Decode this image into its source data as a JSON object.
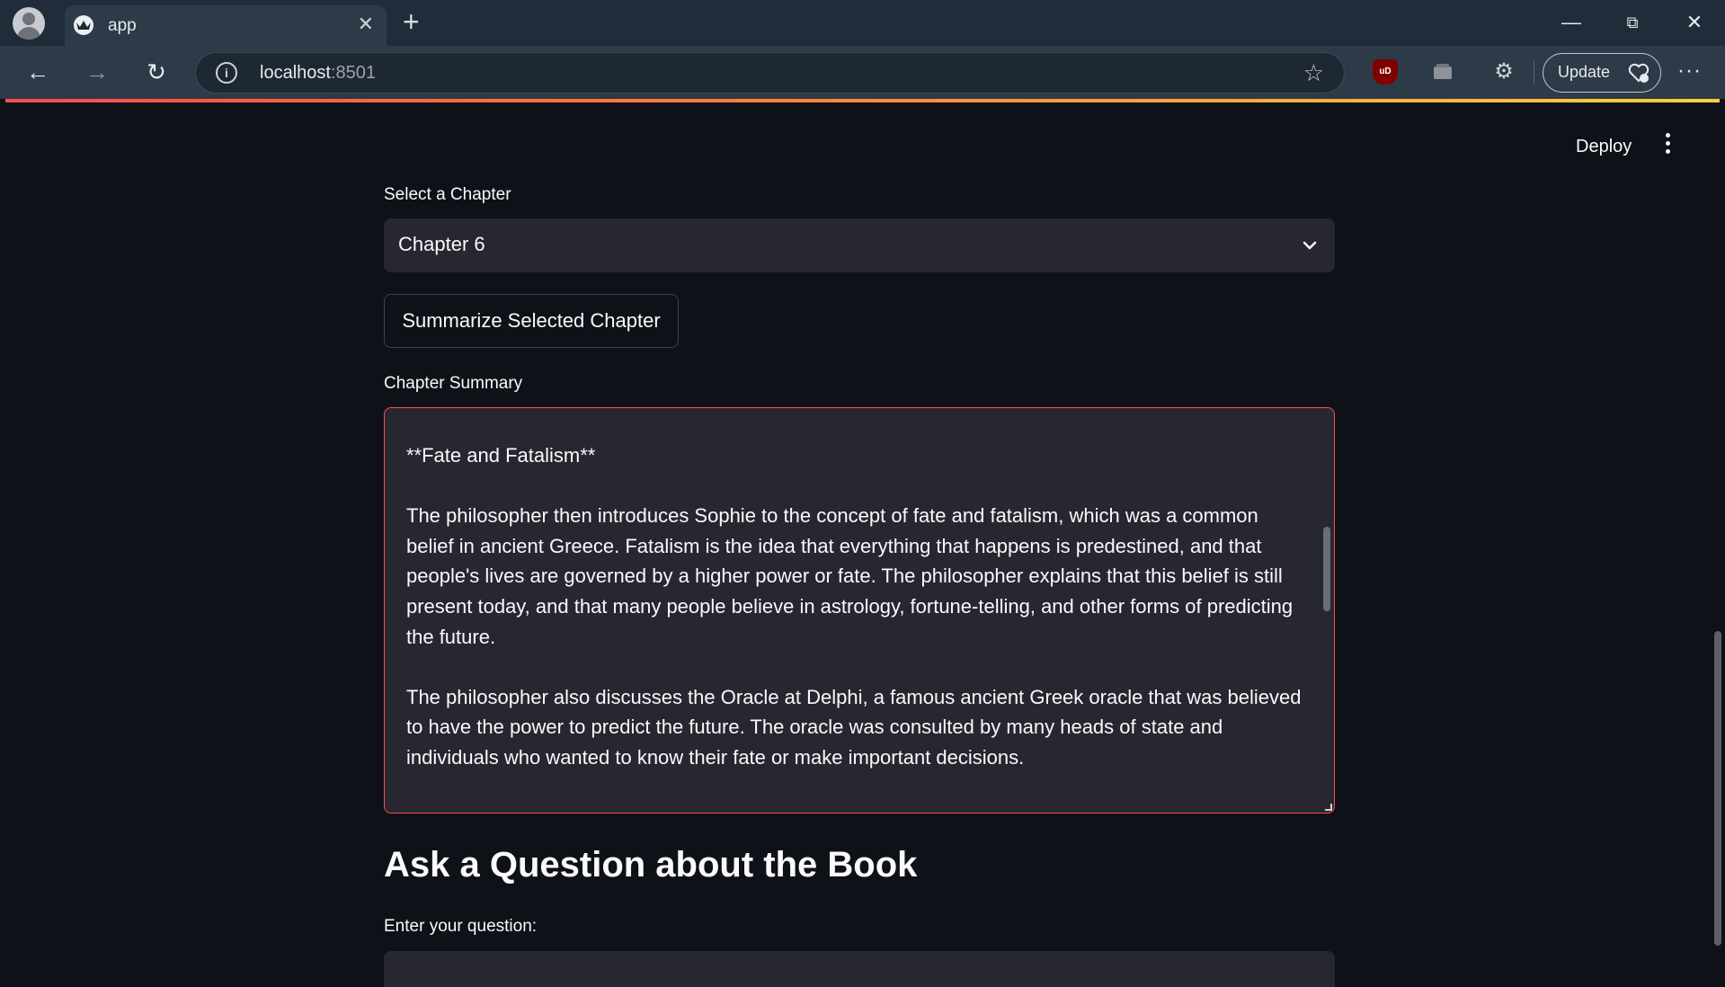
{
  "browser": {
    "tab_title": "app",
    "url_host": "localhost",
    "url_port": ":8501",
    "update_label": "Update",
    "ublock_label": "uD"
  },
  "header": {
    "deploy_label": "Deploy"
  },
  "chapter_select": {
    "label": "Select a Chapter",
    "value": "Chapter 6"
  },
  "summarize_button": {
    "label": "Summarize Selected Chapter"
  },
  "summary": {
    "label": "Chapter Summary",
    "text": "**Fate and Fatalism**\n\nThe philosopher then introduces Sophie to the concept of fate and fatalism, which was a common belief in ancient Greece. Fatalism is the idea that everything that happens is predestined, and that people's lives are governed by a higher power or fate. The philosopher explains that this belief is still present today, and that many people believe in astrology, fortune-telling, and other forms of predicting the future.\n\nThe philosopher also discusses the Oracle at Delphi, a famous ancient Greek oracle that was believed to have the power to predict the future. The oracle was consulted by many heads of state and individuals who wanted to know their fate or make important decisions."
  },
  "question_section": {
    "heading": "Ask a Question about the Book",
    "input_label": "Enter your question:",
    "input_value": ""
  },
  "colors": {
    "background": "#0e1117",
    "widget": "#262730",
    "accent": "#ff4b4b"
  }
}
